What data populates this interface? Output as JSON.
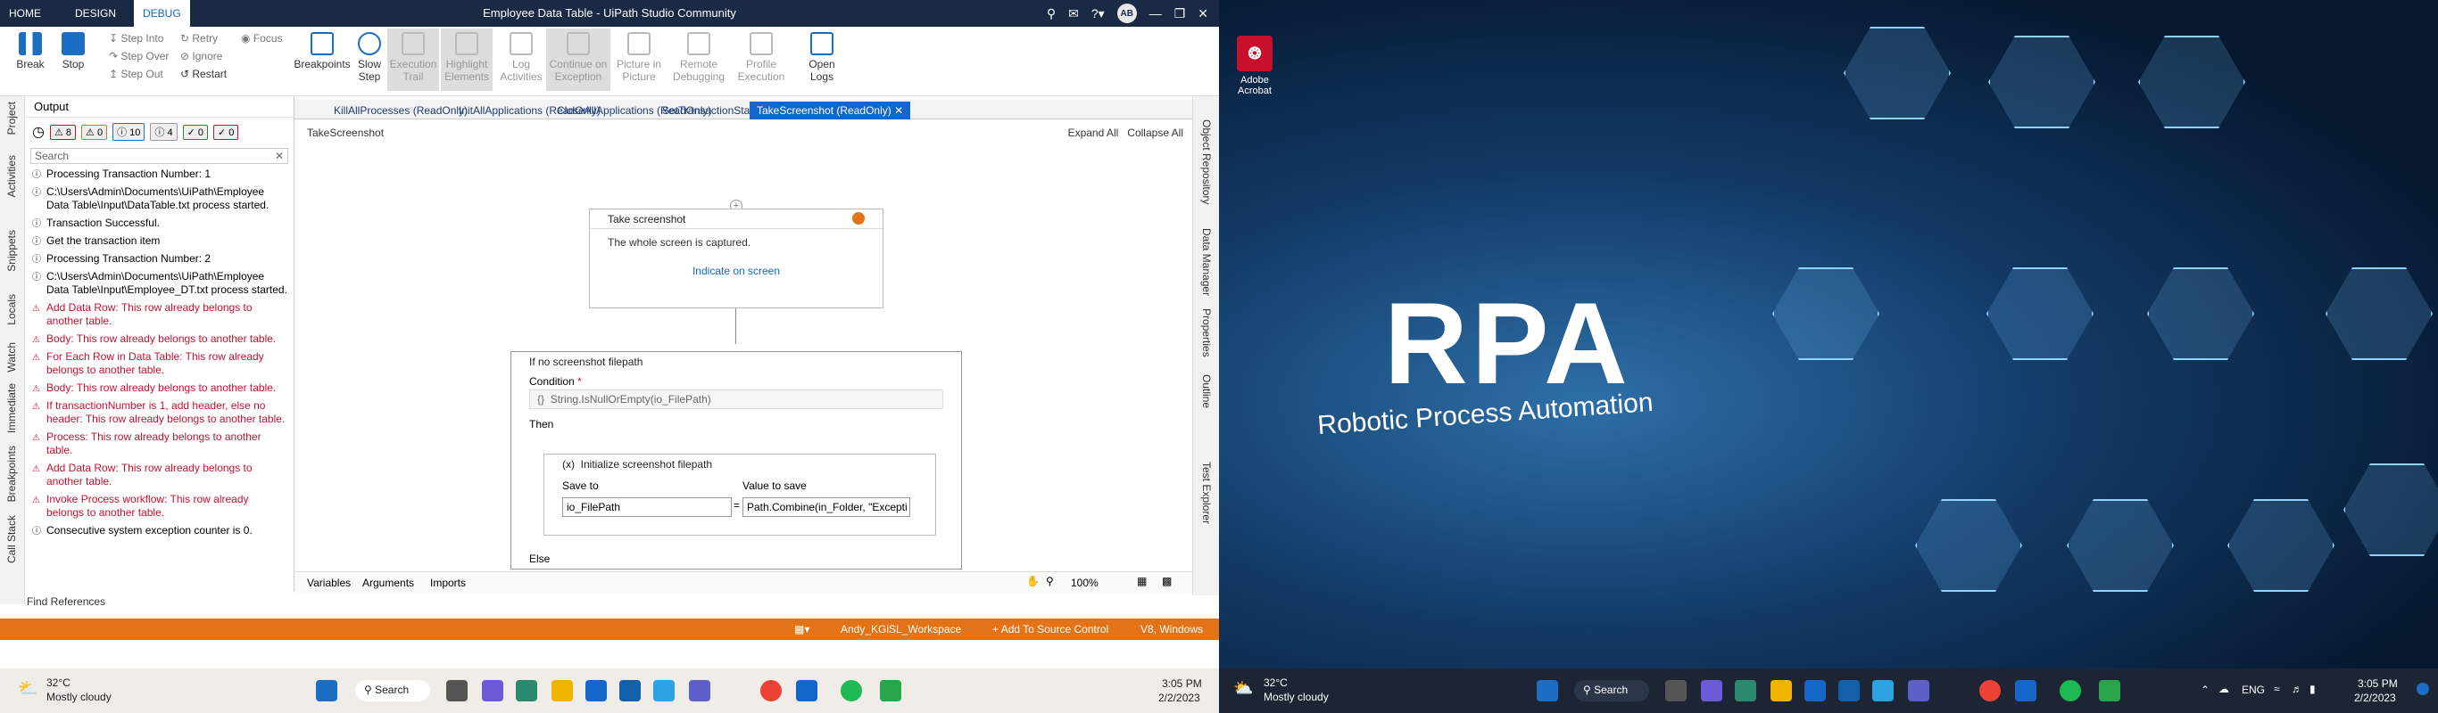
{
  "left": {
    "titlebar": {
      "tabs": [
        "HOME",
        "DESIGN",
        "DEBUG"
      ],
      "title": "Employee Data Table - UiPath Studio Community",
      "avatar": "AB"
    },
    "ribbon": {
      "break": "Break",
      "stop": "Stop",
      "step_into": "Step Into",
      "step_over": "Step Over",
      "step_out": "Step Out",
      "retry": "Retry",
      "ignore": "Ignore",
      "restart": "Restart",
      "focus": "Focus",
      "breakpoints": "Breakpoints",
      "slow_step": "Slow Step",
      "execution_trail": "Execution Trail",
      "highlight_elements": "Highlight Elements",
      "log_activities": "Log Activities",
      "continue_on_exception": "Continue on Exception",
      "picture_in_picture": "Picture in Picture",
      "remote_debugging": "Remote Debugging",
      "profile_execution": "Profile Execution",
      "open_logs": "Open Logs"
    },
    "side_tabs": [
      "Project",
      "Activities",
      "Snippets",
      "Locals",
      "Watch",
      "Immediate",
      "Breakpoints",
      "Call Stack"
    ],
    "output": {
      "title": "Output",
      "filters": [
        "8",
        "0",
        "10",
        "4",
        "0",
        "0"
      ],
      "search_placeholder": "Search",
      "logs": [
        {
          "text": "Processing Transaction Number: 1",
          "level": "info"
        },
        {
          "text": "C:\\Users\\Admin\\Documents\\UiPath\\Employee Data Table\\Input\\DataTable.txt process started.",
          "level": "info"
        },
        {
          "text": "Transaction Successful.",
          "level": "info"
        },
        {
          "text": "Get the transaction item",
          "level": "info"
        },
        {
          "text": "Processing Transaction Number: 2",
          "level": "info"
        },
        {
          "text": "C:\\Users\\Admin\\Documents\\UiPath\\Employee Data Table\\Input\\Employee_DT.txt process started.",
          "level": "info"
        },
        {
          "text": "Add Data Row: This row already belongs to another table.",
          "level": "err"
        },
        {
          "text": "Body: This row already belongs to another table.",
          "level": "err"
        },
        {
          "text": "For Each Row in Data Table: This row already belongs to another table.",
          "level": "err"
        },
        {
          "text": "Body: This row already belongs to another table.",
          "level": "err"
        },
        {
          "text": "If transactionNumber is 1, add header, else no header: This row already belongs to another table.",
          "level": "err"
        },
        {
          "text": "Process: This row already belongs to another table.",
          "level": "err"
        },
        {
          "text": "Add Data Row: This row already belongs to another table.",
          "level": "err"
        },
        {
          "text": "Invoke Process workflow: This row already belongs to another table.",
          "level": "err"
        },
        {
          "text": "Consecutive system exception counter is 0.",
          "level": "info"
        }
      ],
      "find_references": "Find References"
    },
    "doc_tabs": [
      "KillAllProcesses (ReadOnly)",
      "InitAllApplications (ReadOnly)",
      "CloseAllApplications (ReadOnly)",
      "SetTransactionStatus (ReadOnly)",
      "TakeScreenshot (ReadOnly)"
    ],
    "designer": {
      "breadcrumb": "TakeScreenshot",
      "expand_all": "Expand All",
      "collapse_all": "Collapse All",
      "take_screenshot": {
        "title": "Take screenshot",
        "desc": "The whole screen is captured.",
        "link": "Indicate on screen"
      },
      "if_block": {
        "title": "If no screenshot filepath",
        "condition_label": "Condition",
        "condition_value": "String.IsNullOrEmpty(io_FilePath)",
        "then": "Then",
        "else": "Else"
      },
      "assign": {
        "title": "Initialize screenshot filepath",
        "save_to_label": "Save to",
        "value_label": "Value to save",
        "save_to": "io_FilePath",
        "value": "Path.Combine(in_Folder, \"Excepti"
      }
    },
    "bottom": {
      "variables": "Variables",
      "arguments": "Arguments",
      "imports": "Imports",
      "zoom": "100%"
    },
    "right_tabs": [
      "Object Repository",
      "Data Manager",
      "Properties",
      "Outline",
      "Test Explorer"
    ],
    "status": {
      "workspace": "Andy_KGiSL_Workspace",
      "source_control": "Add To Source Control",
      "version": "V8, Windows"
    },
    "taskbar": {
      "temp": "32°C",
      "weather": "Mostly cloudy",
      "search": "Search",
      "time": "3:05 PM",
      "date": "2/2/2023"
    }
  },
  "right": {
    "desktop_icon": "Adobe Acrobat",
    "image": {
      "title": "RPA",
      "subtitle": "Robotic Process Automation"
    },
    "taskbar": {
      "temp": "32°C",
      "weather": "Mostly cloudy",
      "search": "Search",
      "lang": "ENG",
      "time": "3:05 PM",
      "date": "2/2/2023"
    }
  }
}
